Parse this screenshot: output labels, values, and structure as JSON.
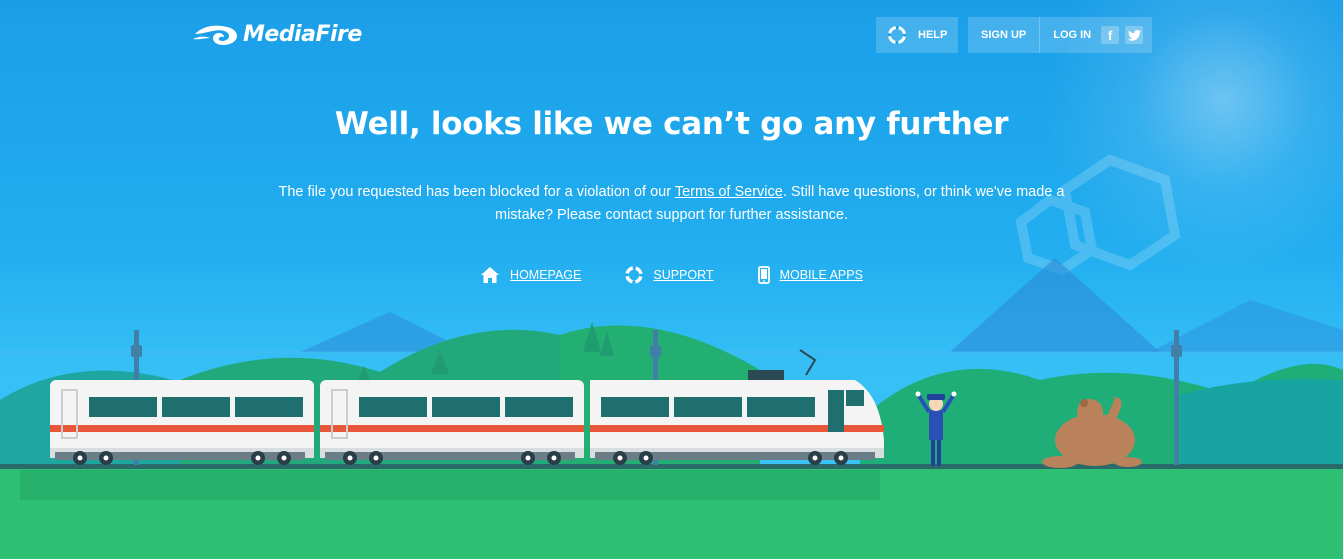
{
  "brand": {
    "name": "MediaFire"
  },
  "header": {
    "help_label": "HELP",
    "signup_label": "SIGN UP",
    "login_label": "LOG IN",
    "social": [
      "facebook-icon",
      "twitter-icon"
    ]
  },
  "main": {
    "headline": "Well, looks like we can’t go any further",
    "message_before": "The file you requested has been blocked for a violation of our ",
    "message_link": "Terms of Service",
    "message_after": ". Still have questions, or think we've made a mistake? Please contact support for further assistance.",
    "links": [
      {
        "label": "HOMEPAGE",
        "icon": "home-icon"
      },
      {
        "label": "SUPPORT",
        "icon": "lifebuoy-icon"
      },
      {
        "label": "MOBILE APPS",
        "icon": "phone-icon"
      }
    ]
  },
  "colors": {
    "sky_top": "#1a9ee8",
    "sky_bottom": "#42c7f7",
    "grass": "#2dbf72",
    "hills": "#1fae6b",
    "train_stripe": "#e8573a",
    "train_window": "#1e6f6e"
  }
}
